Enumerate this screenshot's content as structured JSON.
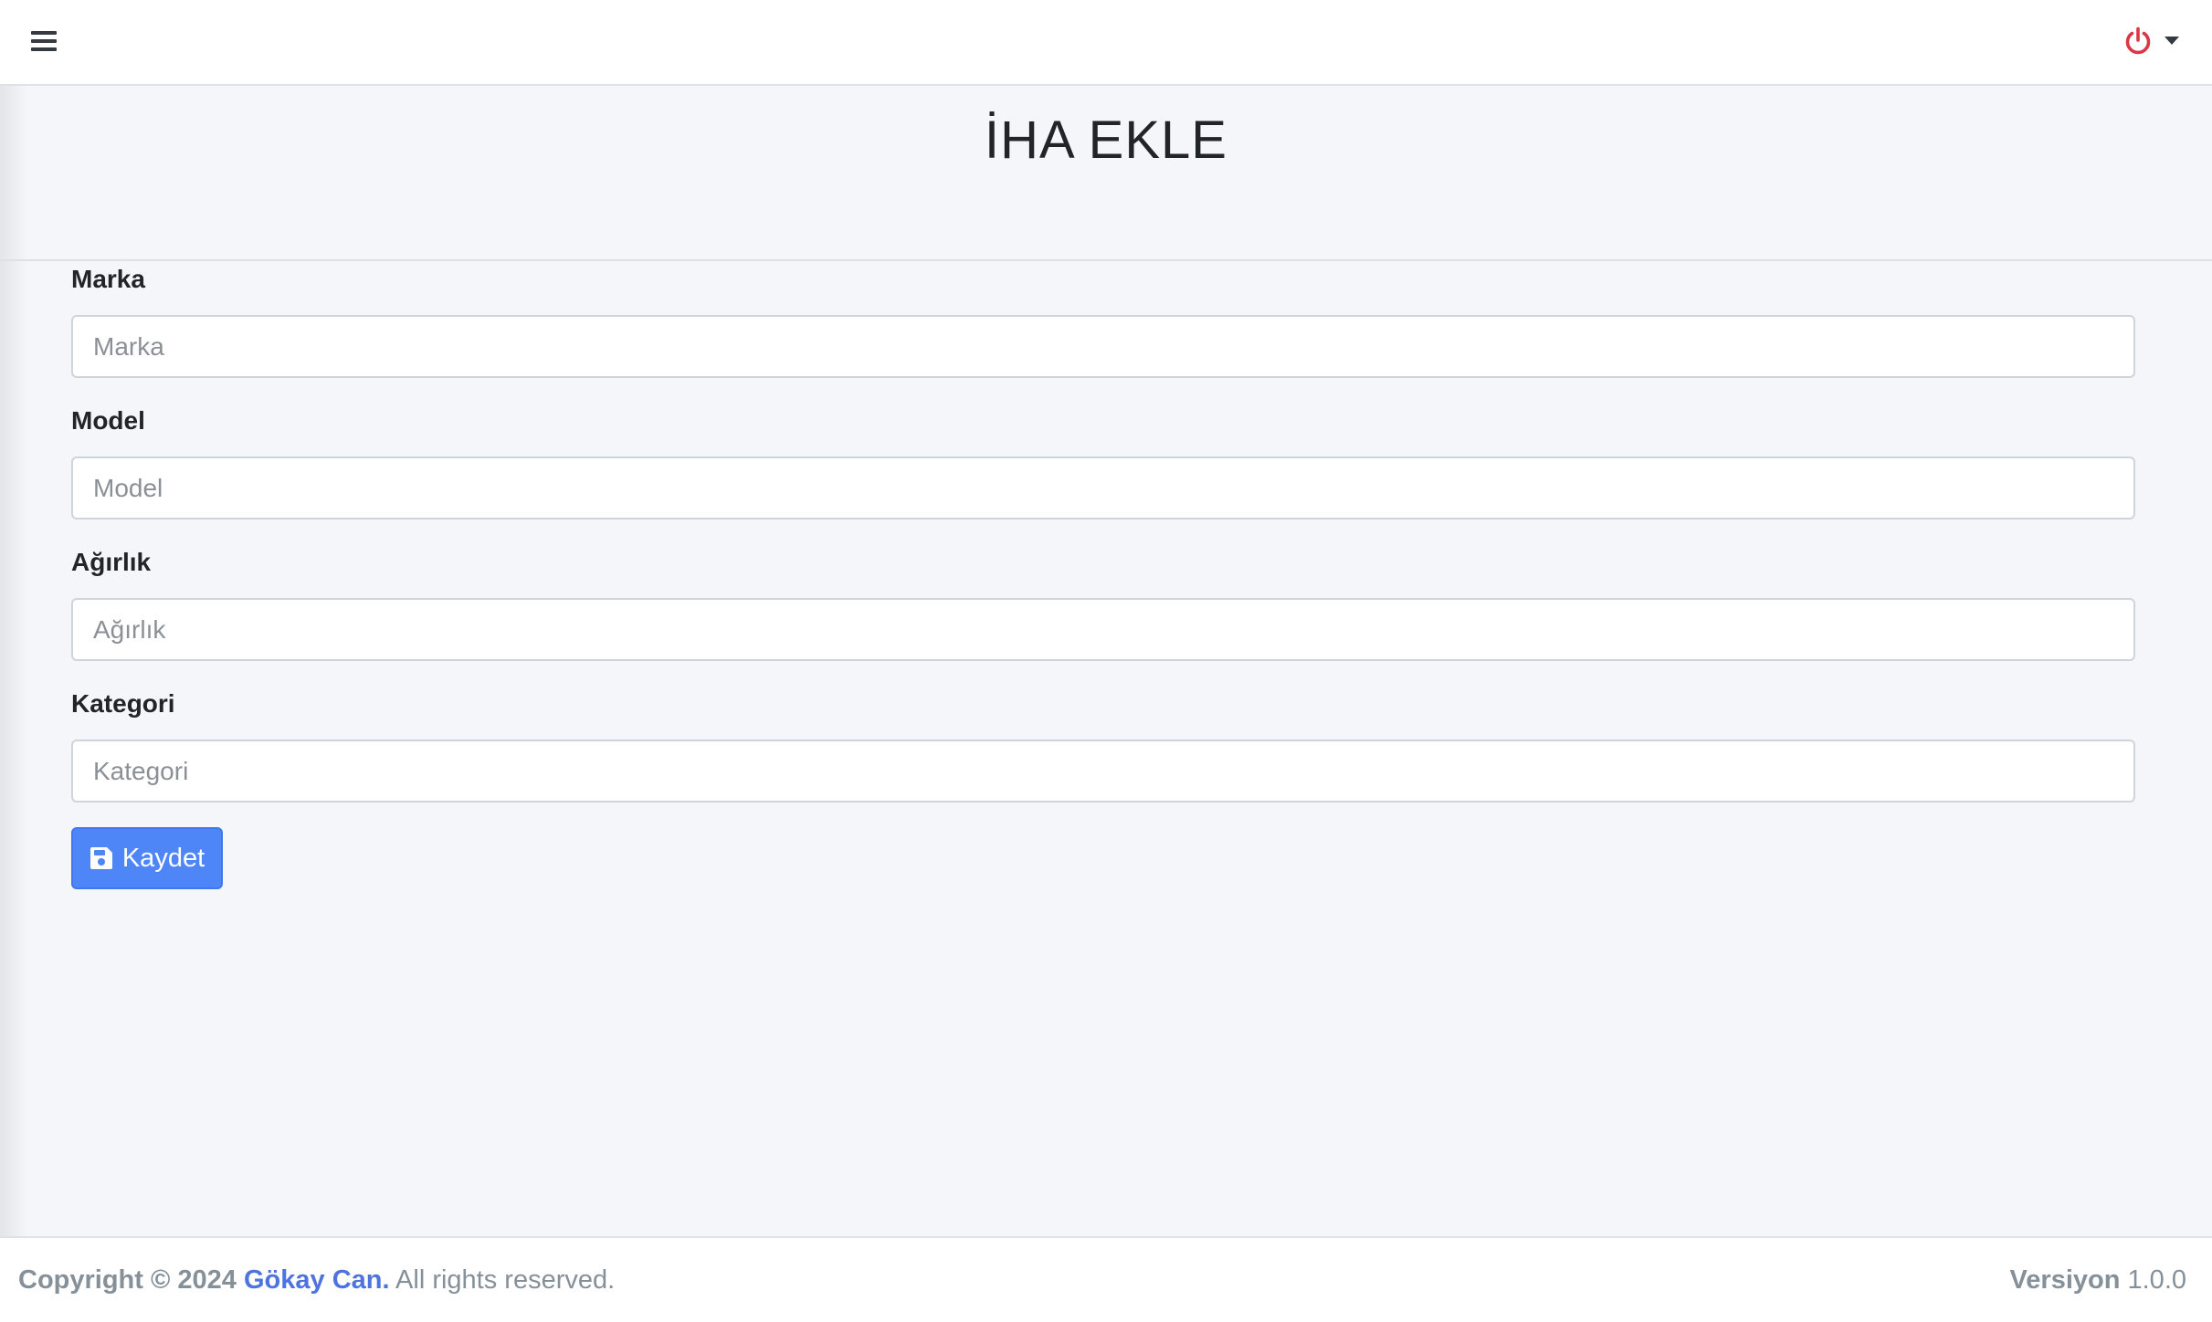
{
  "navbar": {
    "menu_icon": "hamburger-icon",
    "power_icon": "power-icon",
    "power_color": "#dc3545",
    "dropdown_icon": "caret-down-icon"
  },
  "page": {
    "title": "İHA EKLE"
  },
  "form": {
    "fields": [
      {
        "label": "Marka",
        "placeholder": "Marka",
        "value": ""
      },
      {
        "label": "Model",
        "placeholder": "Model",
        "value": ""
      },
      {
        "label": "Ağırlık",
        "placeholder": "Ağırlık",
        "value": ""
      },
      {
        "label": "Kategori",
        "placeholder": "Kategori",
        "value": ""
      }
    ],
    "save_button": {
      "label": "Kaydet",
      "icon": "save-icon",
      "color": "#4e85f7"
    }
  },
  "footer": {
    "copyright_prefix": "Copyright © 2024",
    "author": "Gökay Can.",
    "rights": "All rights reserved.",
    "version_label": "Versiyon",
    "version_value": "1.0.0",
    "link_color": "#4e73df"
  }
}
